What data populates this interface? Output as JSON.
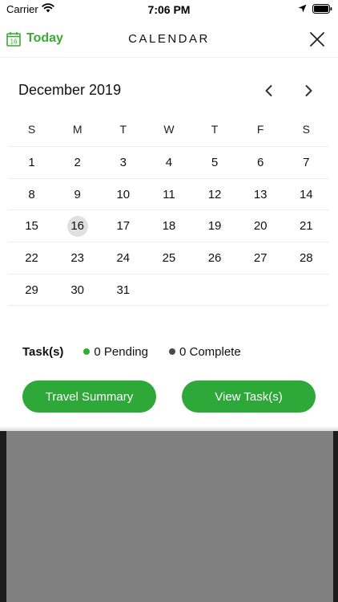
{
  "status_bar": {
    "carrier": "Carrier",
    "time": "7:06 PM"
  },
  "header": {
    "today_label": "Today",
    "today_icon_day": "16",
    "title": "CALENDAR"
  },
  "calendar": {
    "month_label": "December 2019",
    "weekdays": [
      "S",
      "M",
      "T",
      "W",
      "T",
      "F",
      "S"
    ],
    "weeks": [
      [
        "1",
        "2",
        "3",
        "4",
        "5",
        "6",
        "7"
      ],
      [
        "8",
        "9",
        "10",
        "11",
        "12",
        "13",
        "14"
      ],
      [
        "15",
        "16",
        "17",
        "18",
        "19",
        "20",
        "21"
      ],
      [
        "22",
        "23",
        "24",
        "25",
        "26",
        "27",
        "28"
      ],
      [
        "29",
        "30",
        "31",
        "",
        "",
        "",
        ""
      ]
    ],
    "selected_day": "16"
  },
  "tasks": {
    "label": "Task(s)",
    "pending": "0 Pending",
    "complete": "0 Complete"
  },
  "buttons": {
    "travel_summary": "Travel Summary",
    "view_tasks": "View Task(s)"
  },
  "colors": {
    "accent": "#3aa935",
    "button": "#2fa83a",
    "selected_day_bg": "#e0e0e0",
    "pending_dot": "#2db02d",
    "complete_dot": "#4a4a4a"
  },
  "icons": {
    "wifi": "wifi-icon",
    "location": "location-arrow-icon",
    "battery": "battery-icon",
    "today": "calendar-icon",
    "close": "close-icon",
    "prev": "chevron-left-icon",
    "next": "chevron-right-icon"
  }
}
